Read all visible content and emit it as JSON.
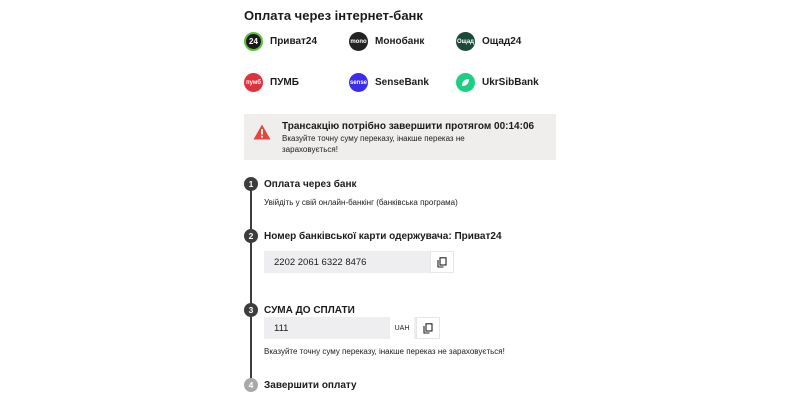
{
  "section_title": "Оплата через інтернет-банк",
  "banks": [
    {
      "label": "Приват24",
      "logo_text": "24",
      "color": "#1a1a1a",
      "ring": "#5ac437"
    },
    {
      "label": "Монобанк",
      "logo_text": "mono",
      "color": "#222222"
    },
    {
      "label": "Ощад24",
      "logo_text": "Ощад",
      "color": "#1b4a39"
    },
    {
      "label": "ПУМБ",
      "logo_text": "пумб",
      "color": "#e0313e"
    },
    {
      "label": "SenseBank",
      "logo_text": "sense",
      "color": "#3c2cf0"
    },
    {
      "label": "UkrSibBank",
      "logo_text": "",
      "color": "#1ccf82"
    }
  ],
  "alert": {
    "main_text": "Трансакцію потрібно завершити протягом 00:14:06",
    "sub_text": "Вказуйте точну суму переказу, інакше переказ не зараховується!",
    "icon_color": "#e8463b"
  },
  "steps": [
    {
      "number": "1",
      "title": "Оплата через банк",
      "description": "Увійдіть у свій онлайн-банкінг (банківська програма)"
    },
    {
      "number": "2",
      "title": "Номер банківської карти одержувача: Приват24",
      "card_number": "2202 2061 6322 8476"
    },
    {
      "number": "3",
      "title": "СУМА ДО СПЛАТИ",
      "amount": "111",
      "currency": "UAH",
      "warning": "Вказуйте точну суму переказу, інакше переказ не зараховується!"
    },
    {
      "number": "4",
      "title": "Завершити оплату"
    }
  ],
  "colors": {
    "timeline": "#3d3d3d",
    "inactive_step": "#a9a9a9",
    "field_bg": "#eeeef1",
    "alert_bg": "#f0eeec"
  }
}
